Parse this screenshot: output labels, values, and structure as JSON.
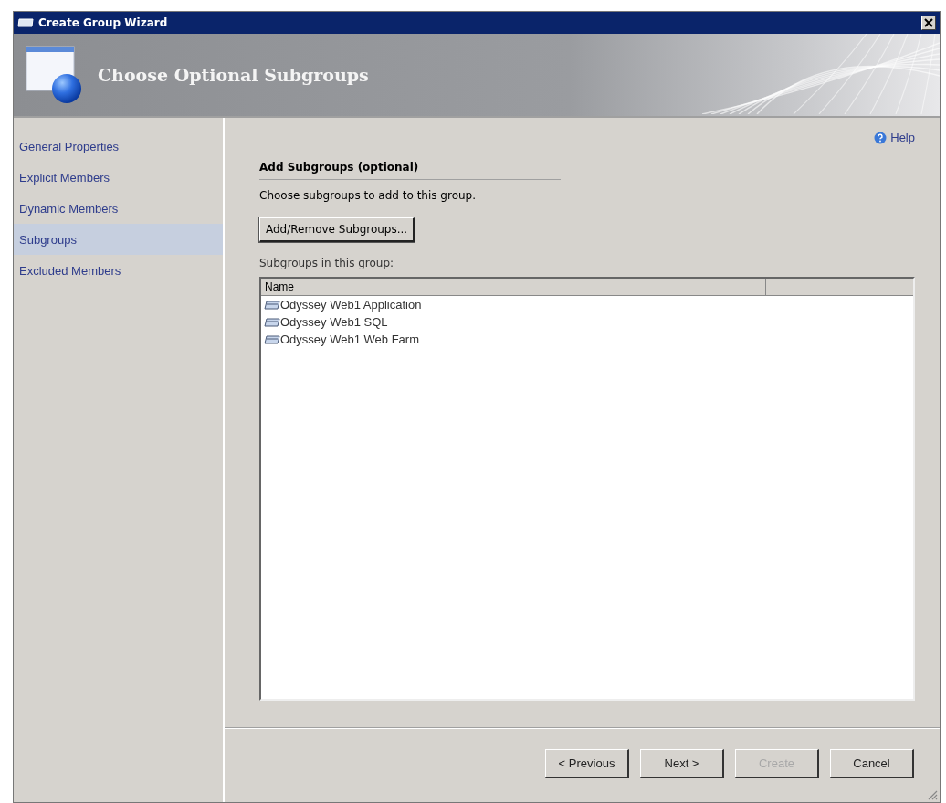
{
  "window": {
    "title": "Create Group Wizard"
  },
  "header": {
    "title": "Choose Optional Subgroups"
  },
  "sidebar": {
    "items": [
      {
        "label": "General Properties",
        "selected": false
      },
      {
        "label": "Explicit Members",
        "selected": false
      },
      {
        "label": "Dynamic Members",
        "selected": false
      },
      {
        "label": "Subgroups",
        "selected": true
      },
      {
        "label": "Excluded Members",
        "selected": false
      }
    ]
  },
  "help": "Help",
  "section": {
    "title": "Add  Subgroups (optional)",
    "description": "Choose subgroups to add to this group.",
    "button": "Add/Remove Subgroups...",
    "list_label": "Subgroups in this group:"
  },
  "table": {
    "columns": [
      "Name"
    ],
    "rows": [
      "Odyssey Web1 Application",
      "Odyssey Web1 SQL",
      "Odyssey Web1 Web Farm"
    ]
  },
  "buttons": [
    {
      "label": "< Previous",
      "disabled": false
    },
    {
      "label": "Next >",
      "disabled": false
    },
    {
      "label": "Create",
      "disabled": true
    },
    {
      "label": "Cancel",
      "disabled": false
    }
  ]
}
